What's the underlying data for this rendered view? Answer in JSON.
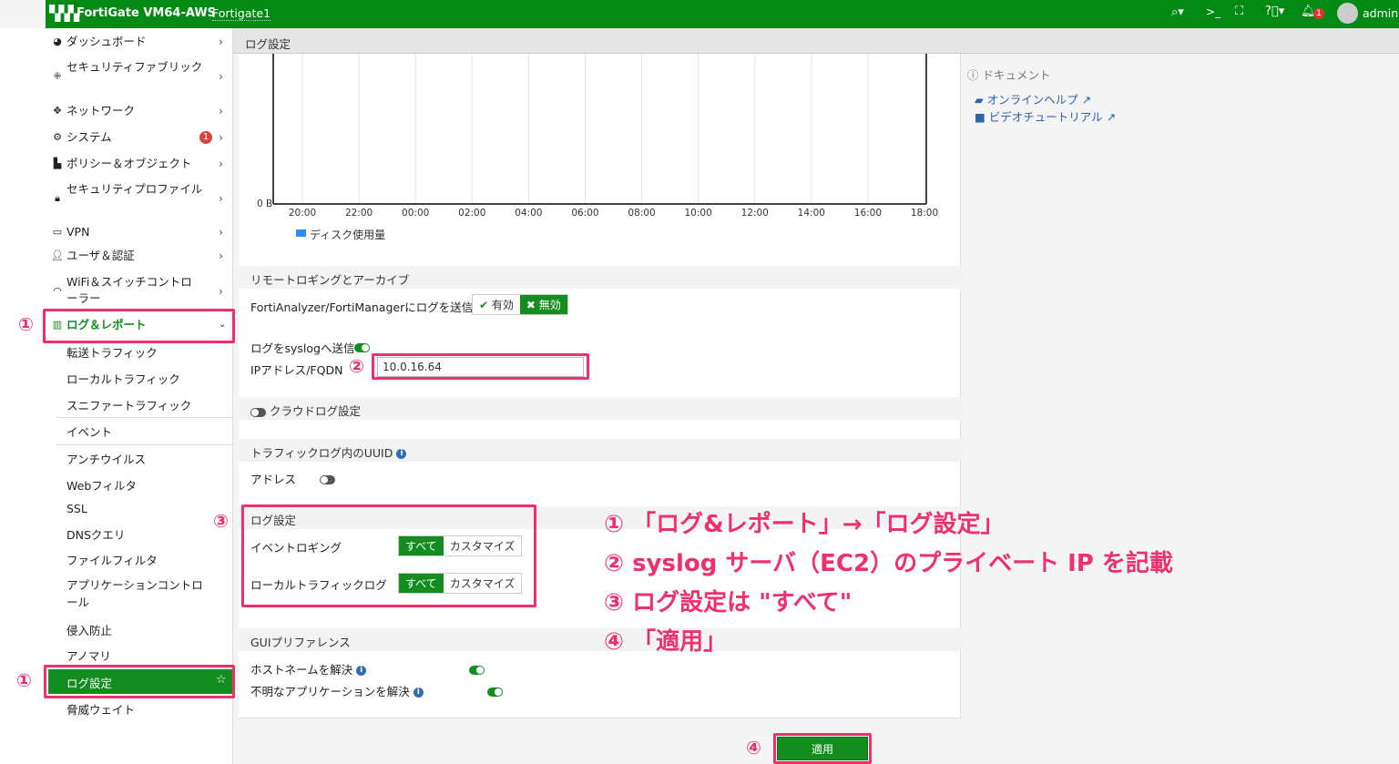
{
  "header": {
    "product": "FortiGate VM64-AWS",
    "hostname": "Fortigate1",
    "user": "admin",
    "notif_count": "1",
    "brand_color": "#038a14"
  },
  "sidebar": {
    "items": [
      {
        "label": "ダッシュボード",
        "icon": "dashboard-icon"
      },
      {
        "label": "セキュリティファブリック",
        "icon": "fabric-icon"
      },
      {
        "label": "ネットワーク",
        "icon": "network-icon"
      },
      {
        "label": "システム",
        "icon": "gear-icon",
        "badge": "1"
      },
      {
        "label": "ポリシー＆オブジェクト",
        "icon": "policy-icon"
      },
      {
        "label": "セキュリティプロファイル",
        "icon": "lock-icon"
      },
      {
        "label": "VPN",
        "icon": "laptop-icon"
      },
      {
        "label": "ユーザ＆認証",
        "icon": "user-icon"
      },
      {
        "label": "WiFi＆スイッチコントローラー",
        "icon": "wifi-icon"
      },
      {
        "label": "ログ＆レポート",
        "icon": "chart-icon"
      }
    ],
    "sub": [
      "転送トラフィック",
      "ローカルトラフィック",
      "スニファートラフィック",
      "イベント",
      "アンチウイルス",
      "Webフィルタ",
      "SSL",
      "DNSクエリ",
      "ファイルフィルタ",
      "アプリケーションコントロール",
      "侵入防止",
      "アノマリ",
      "ログ設定",
      "脅威ウェイト"
    ]
  },
  "breadcrumb": "ログ設定",
  "chart_data": {
    "type": "line",
    "y_tick": "0 B",
    "x_ticks": [
      "20:00",
      "22:00",
      "00:00",
      "02:00",
      "04:00",
      "06:00",
      "08:00",
      "10:00",
      "12:00",
      "14:00",
      "16:00",
      "18:00"
    ],
    "legend": "ディスク使用量",
    "legend_color": "#2d8ff0"
  },
  "remote": {
    "title": "リモートロギングとアーカイブ",
    "faz_label": "FortiAnalyzer/FortiManagerにログを送信",
    "enable": "有効",
    "disable": "無効",
    "faz_state": "無効",
    "syslog_label": "ログをsyslogへ送信",
    "syslog_on": true,
    "ip_label": "IPアドレス/FQDN",
    "ip_value": "10.0.16.64"
  },
  "cloud": {
    "label": "クラウドログ設定",
    "on": false
  },
  "uuid": {
    "title": "トラフィックログ内のUUID",
    "address_label": "アドレス",
    "on": false
  },
  "logset": {
    "title": "ログ設定",
    "event_label": "イベントロギング",
    "local_label": "ローカルトラフィックログ",
    "all": "すべて",
    "custom": "カスタマイズ"
  },
  "gui": {
    "title": "GUIプリファレンス",
    "host_label": "ホストネームを解決",
    "app_label": "不明なアプリケーションを解決"
  },
  "docs": {
    "title": "ドキュメント",
    "help": "オンラインヘルプ",
    "video": "ビデオチュートリアル"
  },
  "apply": "適用",
  "annotations": {
    "n1": "①",
    "n2": "②",
    "n3": "③",
    "n4": "④",
    "l1": "① 「ログ&レポート」→「ログ設定」",
    "l2": "② syslog サーバ（EC2）のプライベート IP を記載",
    "l3": "③ ログ設定は \"すべて\"",
    "l4": "④ 「適用」"
  }
}
